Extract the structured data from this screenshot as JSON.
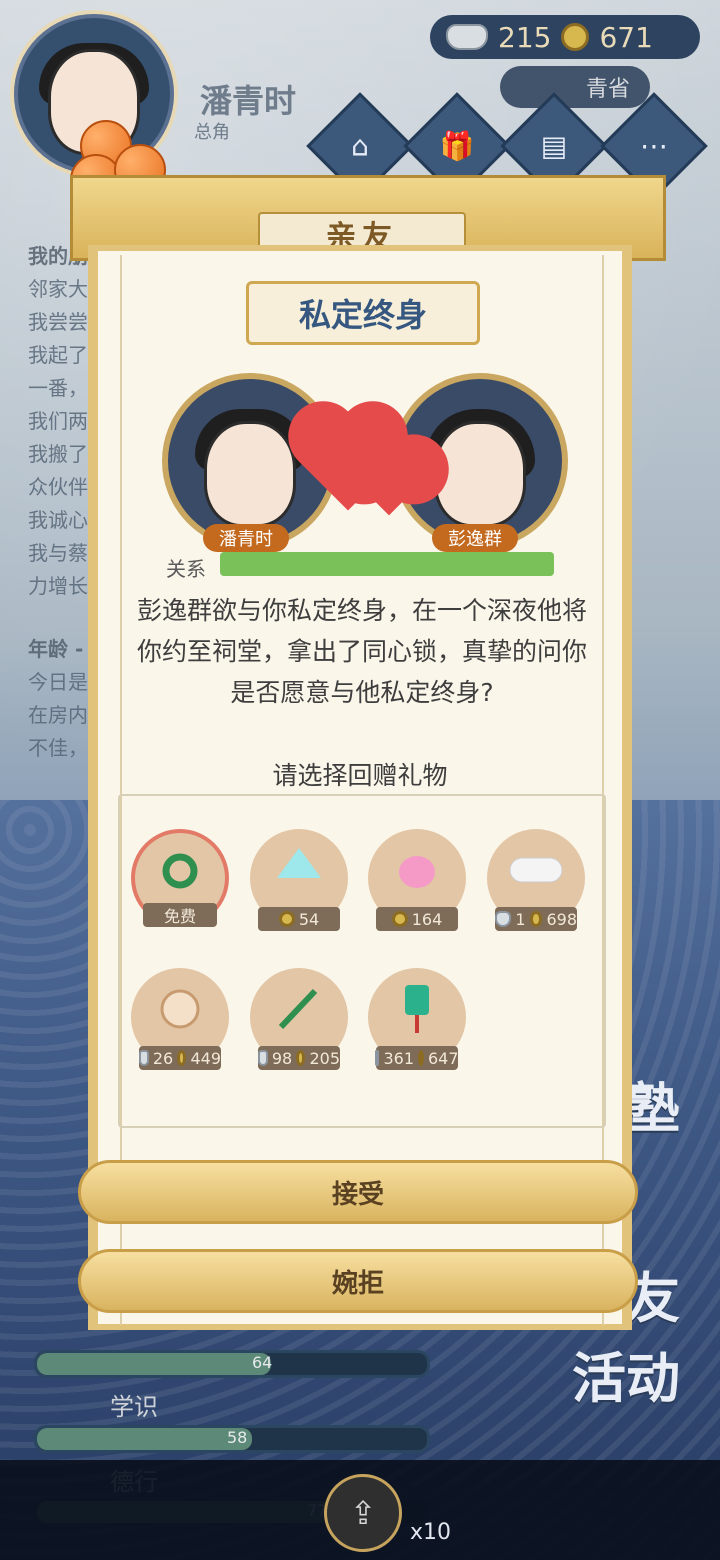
{
  "player": {
    "name": "潘青时",
    "role": "总角"
  },
  "currency": {
    "silver": "215",
    "copper": "671"
  },
  "status_pill": "青省",
  "top_menu": [
    "东又",
    "行囊",
    "账本",
    "更单"
  ],
  "background_text": [
    "我的朋",
    "邻家大",
    "我尝尝",
    "我起了",
    "一番，",
    "我们两",
    "我搬了",
    "众伙伴",
    "我诚心",
    "我与蔡",
    "力增长",
    "年龄 -",
    "今日是",
    "在房内",
    "不佳，"
  ],
  "modal": {
    "header": "亲友",
    "event_title": "私定终身",
    "left_name": "潘青时",
    "right_name": "彭逸群",
    "relation_label": "关系",
    "relation_progress": 1.0,
    "story": "彭逸群欲与你私定终身，在一个深夜他将你约至祠堂，拿出了同心锁，真挚的问你是否愿意与他私定终身?",
    "prompt": "请选择回赠礼物",
    "accept": "接受",
    "decline": "婉拒"
  },
  "gifts": [
    {
      "name": "mint-wreath",
      "price": "免费",
      "selected": true
    },
    {
      "name": "blue-handkerchief",
      "price": "54"
    },
    {
      "name": "pink-sachet",
      "price": "164"
    },
    {
      "name": "white-comb",
      "price_silver": "1",
      "price_copper": "698"
    },
    {
      "name": "jade-pendant",
      "price_silver": "26",
      "price_copper": "449"
    },
    {
      "name": "green-hairpin",
      "price_silver": "98",
      "price_copper": "205"
    },
    {
      "name": "green-charm",
      "price_silver": "361",
      "price_copper": "647"
    }
  ],
  "stats": [
    {
      "label": "学识",
      "value": "58"
    },
    {
      "label": "德行",
      "value": "77"
    },
    {
      "label": "",
      "value": "64"
    }
  ],
  "side_words": [
    "闺塾",
    "亲友",
    "活动"
  ],
  "bottom": {
    "multiplier": "x10"
  }
}
